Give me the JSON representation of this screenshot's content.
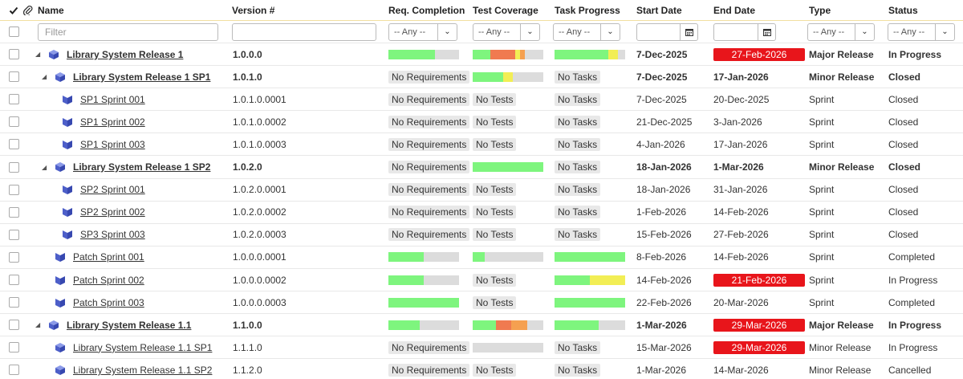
{
  "headers": {
    "name": "Name",
    "version": "Version #",
    "req": "Req. Completion",
    "test": "Test Coverage",
    "task": "Task Progress",
    "start": "Start Date",
    "end": "End Date",
    "type": "Type",
    "status": "Status"
  },
  "filters": {
    "name_placeholder": "Filter",
    "any": "-- Any --"
  },
  "colors": {
    "green": "#7ef57e",
    "gray": "#dcdcdc",
    "orange": "#f07a50",
    "light_orange": "#f5a050",
    "yellow": "#f2ee55",
    "overdue_red": "#e8151b",
    "icon_blue": "#4d5fc9"
  },
  "rows": [
    {
      "name": "Library System Release 1",
      "version": "1.0.0.0",
      "level": 0,
      "expand": true,
      "kind": "release",
      "bold": true,
      "req": {
        "type": "bar",
        "segs": [
          {
            "p": 66,
            "c": "green"
          }
        ]
      },
      "test": {
        "type": "bar",
        "segs": [
          {
            "p": 25,
            "c": "green"
          },
          {
            "p": 35,
            "c": "orange"
          },
          {
            "p": 7,
            "c": "yellow"
          },
          {
            "p": 7,
            "c": "light_orange"
          }
        ]
      },
      "task": {
        "type": "bar",
        "segs": [
          {
            "p": 76,
            "c": "green"
          },
          {
            "p": 14,
            "c": "yellow"
          }
        ]
      },
      "start": "7-Dec-2025",
      "end": "27-Feb-2026",
      "end_overdue": true,
      "type": "Major Release",
      "status": "In Progress"
    },
    {
      "name": "Library System Release 1 SP1",
      "version": "1.0.1.0",
      "level": 1,
      "expand": true,
      "kind": "release",
      "bold": true,
      "req": {
        "type": "text",
        "text": "No Requirements"
      },
      "test": {
        "type": "bar",
        "segs": [
          {
            "p": 43,
            "c": "green"
          },
          {
            "p": 14,
            "c": "yellow"
          }
        ]
      },
      "task": {
        "type": "text",
        "text": "No Tasks"
      },
      "start": "7-Dec-2025",
      "end": "17-Jan-2026",
      "end_overdue": false,
      "type": "Minor Release",
      "status": "Closed"
    },
    {
      "name": "SP1 Sprint 001",
      "version": "1.0.1.0.0001",
      "level": 2,
      "expand": false,
      "kind": "sprint",
      "bold": false,
      "req": {
        "type": "text",
        "text": "No Requirements"
      },
      "test": {
        "type": "text",
        "text": "No Tests"
      },
      "task": {
        "type": "text",
        "text": "No Tasks"
      },
      "start": "7-Dec-2025",
      "end": "20-Dec-2025",
      "end_overdue": false,
      "type": "Sprint",
      "status": "Closed"
    },
    {
      "name": "SP1 Sprint 002",
      "version": "1.0.1.0.0002",
      "level": 2,
      "expand": false,
      "kind": "sprint",
      "bold": false,
      "req": {
        "type": "text",
        "text": "No Requirements"
      },
      "test": {
        "type": "text",
        "text": "No Tests"
      },
      "task": {
        "type": "text",
        "text": "No Tasks"
      },
      "start": "21-Dec-2025",
      "end": "3-Jan-2026",
      "end_overdue": false,
      "type": "Sprint",
      "status": "Closed"
    },
    {
      "name": "SP1 Sprint 003",
      "version": "1.0.1.0.0003",
      "level": 2,
      "expand": false,
      "kind": "sprint",
      "bold": false,
      "req": {
        "type": "text",
        "text": "No Requirements"
      },
      "test": {
        "type": "text",
        "text": "No Tests"
      },
      "task": {
        "type": "text",
        "text": "No Tasks"
      },
      "start": "4-Jan-2026",
      "end": "17-Jan-2026",
      "end_overdue": false,
      "type": "Sprint",
      "status": "Closed"
    },
    {
      "name": "Library System Release 1 SP2",
      "version": "1.0.2.0",
      "level": 1,
      "expand": true,
      "kind": "release",
      "bold": true,
      "req": {
        "type": "text",
        "text": "No Requirements"
      },
      "test": {
        "type": "bar",
        "segs": [
          {
            "p": 100,
            "c": "green"
          }
        ]
      },
      "task": {
        "type": "text",
        "text": "No Tasks"
      },
      "start": "18-Jan-2026",
      "end": "1-Mar-2026",
      "end_overdue": false,
      "type": "Minor Release",
      "status": "Closed"
    },
    {
      "name": "SP2 Sprint 001",
      "version": "1.0.2.0.0001",
      "level": 2,
      "expand": false,
      "kind": "sprint",
      "bold": false,
      "req": {
        "type": "text",
        "text": "No Requirements"
      },
      "test": {
        "type": "text",
        "text": "No Tests"
      },
      "task": {
        "type": "text",
        "text": "No Tasks"
      },
      "start": "18-Jan-2026",
      "end": "31-Jan-2026",
      "end_overdue": false,
      "type": "Sprint",
      "status": "Closed"
    },
    {
      "name": "SP2 Sprint 002",
      "version": "1.0.2.0.0002",
      "level": 2,
      "expand": false,
      "kind": "sprint",
      "bold": false,
      "req": {
        "type": "text",
        "text": "No Requirements"
      },
      "test": {
        "type": "text",
        "text": "No Tests"
      },
      "task": {
        "type": "text",
        "text": "No Tasks"
      },
      "start": "1-Feb-2026",
      "end": "14-Feb-2026",
      "end_overdue": false,
      "type": "Sprint",
      "status": "Closed"
    },
    {
      "name": "SP3 Sprint 003",
      "version": "1.0.2.0.0003",
      "level": 2,
      "expand": false,
      "kind": "sprint",
      "bold": false,
      "req": {
        "type": "text",
        "text": "No Requirements"
      },
      "test": {
        "type": "text",
        "text": "No Tests"
      },
      "task": {
        "type": "text",
        "text": "No Tasks"
      },
      "start": "15-Feb-2026",
      "end": "27-Feb-2026",
      "end_overdue": false,
      "type": "Sprint",
      "status": "Closed"
    },
    {
      "name": "Patch Sprint 001",
      "version": "1.0.0.0.0001",
      "level": 1,
      "expand": false,
      "kind": "sprint",
      "bold": false,
      "req": {
        "type": "bar",
        "segs": [
          {
            "p": 50,
            "c": "green"
          }
        ]
      },
      "test": {
        "type": "bar",
        "segs": [
          {
            "p": 17,
            "c": "green"
          }
        ]
      },
      "task": {
        "type": "bar",
        "segs": [
          {
            "p": 100,
            "c": "green"
          }
        ]
      },
      "start": "8-Feb-2026",
      "end": "14-Feb-2026",
      "end_overdue": false,
      "type": "Sprint",
      "status": "Completed"
    },
    {
      "name": "Patch Sprint 002",
      "version": "1.0.0.0.0002",
      "level": 1,
      "expand": false,
      "kind": "sprint",
      "bold": false,
      "req": {
        "type": "bar",
        "segs": [
          {
            "p": 50,
            "c": "green"
          }
        ]
      },
      "test": {
        "type": "text",
        "text": "No Tests"
      },
      "task": {
        "type": "bar",
        "segs": [
          {
            "p": 50,
            "c": "green"
          },
          {
            "p": 50,
            "c": "yellow"
          }
        ]
      },
      "start": "14-Feb-2026",
      "end": "21-Feb-2026",
      "end_overdue": true,
      "type": "Sprint",
      "status": "In Progress"
    },
    {
      "name": "Patch Sprint 003",
      "version": "1.0.0.0.0003",
      "level": 1,
      "expand": false,
      "kind": "sprint",
      "bold": false,
      "req": {
        "type": "bar",
        "segs": [
          {
            "p": 100,
            "c": "green"
          }
        ]
      },
      "test": {
        "type": "text",
        "text": "No Tests"
      },
      "task": {
        "type": "bar",
        "segs": [
          {
            "p": 100,
            "c": "green"
          }
        ]
      },
      "start": "22-Feb-2026",
      "end": "20-Mar-2026",
      "end_overdue": false,
      "type": "Sprint",
      "status": "Completed"
    },
    {
      "name": "Library System Release 1.1",
      "version": "1.1.0.0",
      "level": 0,
      "expand": true,
      "kind": "release",
      "bold": true,
      "req": {
        "type": "bar",
        "segs": [
          {
            "p": 44,
            "c": "green"
          }
        ]
      },
      "test": {
        "type": "bar",
        "segs": [
          {
            "p": 33,
            "c": "green"
          },
          {
            "p": 22,
            "c": "orange"
          },
          {
            "p": 22,
            "c": "light_orange"
          }
        ]
      },
      "task": {
        "type": "bar",
        "segs": [
          {
            "p": 62,
            "c": "green"
          }
        ]
      },
      "start": "1-Mar-2026",
      "end": "29-Mar-2026",
      "end_overdue": true,
      "type": "Major Release",
      "status": "In Progress"
    },
    {
      "name": "Library System Release 1.1 SP1",
      "version": "1.1.1.0",
      "level": 1,
      "expand": false,
      "kind": "release",
      "bold": false,
      "req": {
        "type": "text",
        "text": "No Requirements"
      },
      "test": {
        "type": "bar",
        "segs": []
      },
      "task": {
        "type": "text",
        "text": "No Tasks"
      },
      "start": "15-Mar-2026",
      "end": "29-Mar-2026",
      "end_overdue": true,
      "type": "Minor Release",
      "status": "In Progress"
    },
    {
      "name": "Library System Release 1.1 SP2",
      "version": "1.1.2.0",
      "level": 1,
      "expand": false,
      "kind": "release",
      "bold": false,
      "req": {
        "type": "text",
        "text": "No Requirements"
      },
      "test": {
        "type": "text",
        "text": "No Tests"
      },
      "task": {
        "type": "text",
        "text": "No Tasks"
      },
      "start": "1-Mar-2026",
      "end": "14-Mar-2026",
      "end_overdue": false,
      "type": "Minor Release",
      "status": "Cancelled"
    }
  ]
}
